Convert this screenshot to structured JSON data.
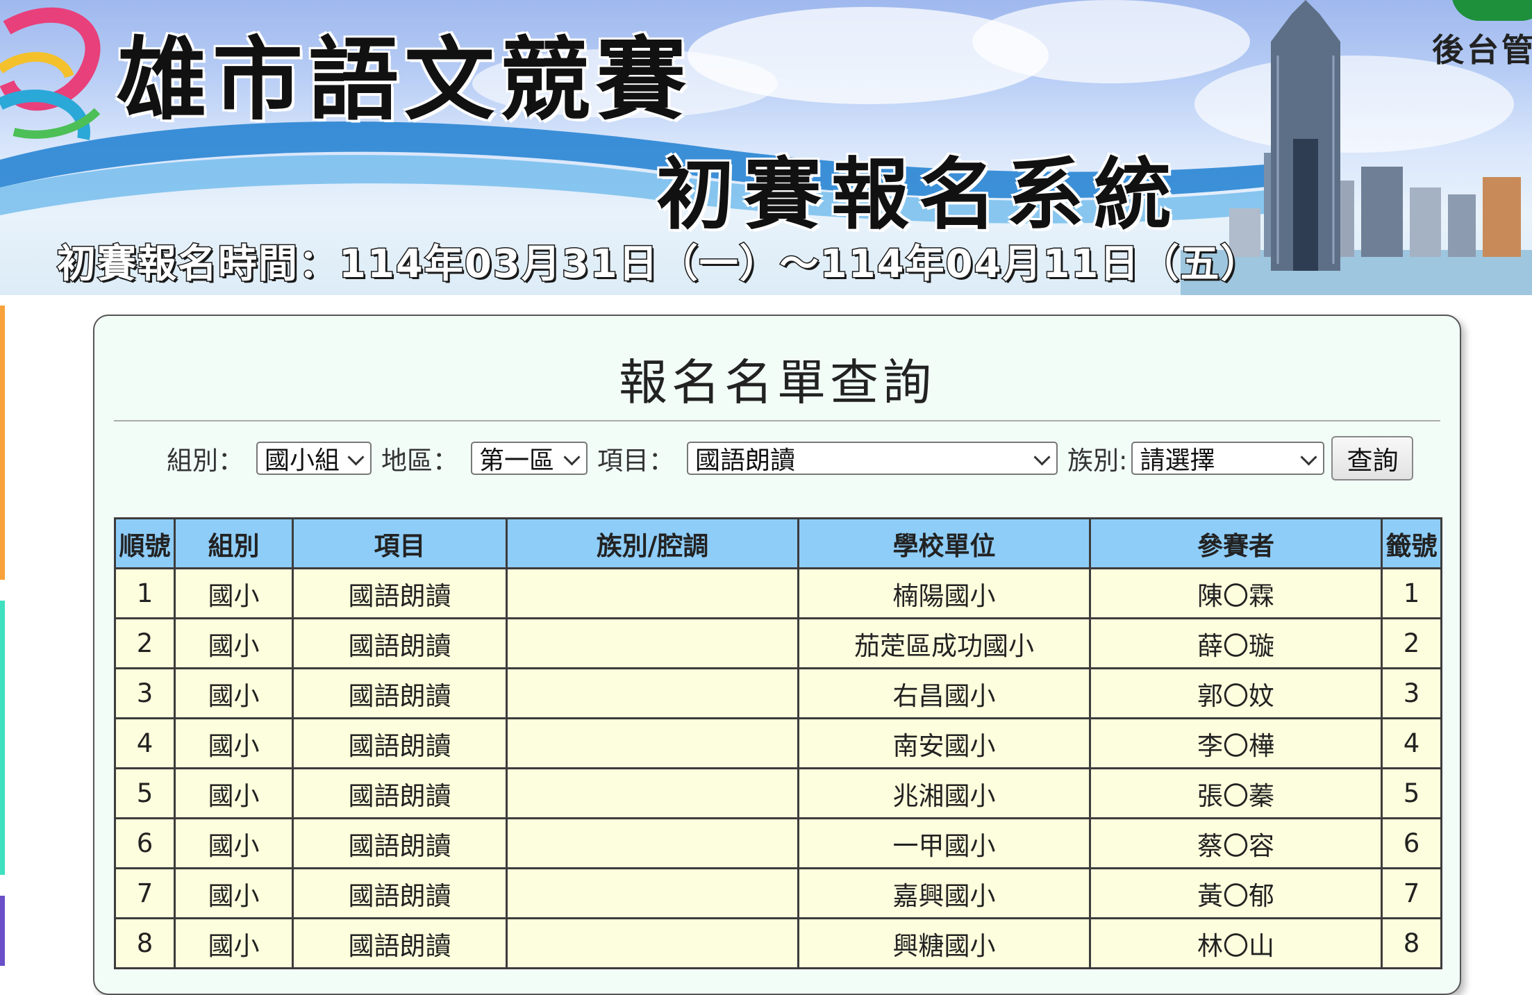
{
  "banner": {
    "title": "雄市語文競賽",
    "subtitle": "初賽報名系統",
    "period": "初賽報名時間：114年03月31日（一）～114年04月11日（五）",
    "admin_link": "後台管"
  },
  "panel": {
    "title": "報名名單查詢"
  },
  "filters": {
    "group_label": "組別：",
    "group_value": "國小組",
    "area_label": "地區：",
    "area_value": "第一區",
    "item_label": "項目：",
    "item_value": "國語朗讀",
    "ethnic_label": "族別:",
    "ethnic_value": "請選擇",
    "query_button": "查詢"
  },
  "table": {
    "headers": [
      "順號",
      "組別",
      "項目",
      "族別/腔調",
      "學校單位",
      "參賽者",
      "籤號"
    ],
    "rows": [
      [
        "1",
        "國小",
        "國語朗讀",
        "",
        "楠陽國小",
        "陳〇霖",
        "1"
      ],
      [
        "2",
        "國小",
        "國語朗讀",
        "",
        "茄萣區成功國小",
        "薛〇璇",
        "2"
      ],
      [
        "3",
        "國小",
        "國語朗讀",
        "",
        "右昌國小",
        "郭〇妏",
        "3"
      ],
      [
        "4",
        "國小",
        "國語朗讀",
        "",
        "南安國小",
        "李〇樺",
        "4"
      ],
      [
        "5",
        "國小",
        "國語朗讀",
        "",
        "兆湘國小",
        "張〇蓁",
        "5"
      ],
      [
        "6",
        "國小",
        "國語朗讀",
        "",
        "一甲國小",
        "蔡〇容",
        "6"
      ],
      [
        "7",
        "國小",
        "國語朗讀",
        "",
        "嘉興國小",
        "黃〇郁",
        "7"
      ],
      [
        "8",
        "國小",
        "國語朗讀",
        "",
        "興糖國小",
        "林〇山",
        "8"
      ]
    ]
  }
}
